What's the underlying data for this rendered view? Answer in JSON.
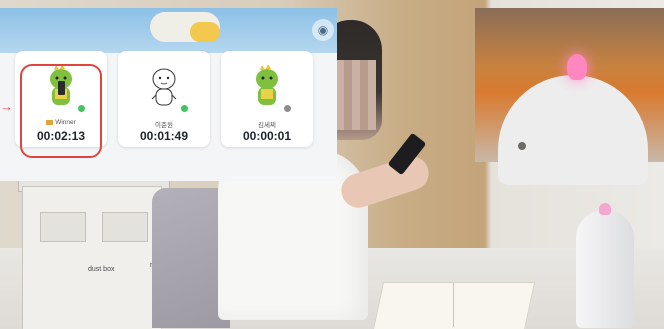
{
  "overlay": {
    "banner_icon": "badge-icon",
    "cards": [
      {
        "name": "Winner",
        "time": "00:02:13",
        "status_color": "#43c463",
        "winner": true,
        "avatar": "green-dino-phone-avatar"
      },
      {
        "name": "이준원",
        "time": "00:01:49",
        "status_color": "#43c463",
        "winner": false,
        "avatar": "white-character-avatar"
      },
      {
        "name": "김세찌",
        "time": "00:00:01",
        "status_color": "#8c8c8c",
        "winner": false,
        "avatar": "green-dino-avatar"
      }
    ],
    "highlight_color": "#e0443e"
  },
  "scene": {
    "bin_label_1": "dust box",
    "bin_label_2": "recy"
  }
}
